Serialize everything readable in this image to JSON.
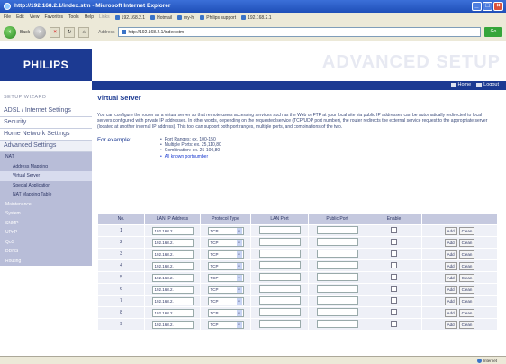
{
  "window": {
    "title": "http://192.168.2.1/index.stm - Microsoft Internet Explorer"
  },
  "menubar": {
    "items": [
      "File",
      "Edit",
      "View",
      "Favorites",
      "Tools",
      "Help"
    ],
    "links_label": "Links",
    "links": [
      "192.168.2.1",
      "Hotmail",
      "my-hi",
      "Philips support",
      "192.168.2.1"
    ]
  },
  "toolbar": {
    "back_label": "Back",
    "address_label": "Address",
    "address_value": "http://192.168.2.1/index.stm",
    "go_label": "Go"
  },
  "header": {
    "logo": "PHILIPS",
    "title": "ADVANCED SETUP",
    "home_label": "Home",
    "logout_label": "Logout"
  },
  "sidebar": {
    "wizard": "SETUP WIZARD",
    "items": [
      "ADSL / Internet Settings",
      "Security",
      "Home Network Settings",
      "Advanced Settings"
    ],
    "nat": "NAT",
    "nat_sub": [
      "Address Mapping",
      "Virtual Server",
      "Special Application",
      "NAT Mapping Table"
    ],
    "other": [
      "Maintenance",
      "System",
      "SNMP",
      "UPnP",
      "QoS",
      "DDNS",
      "Routing"
    ]
  },
  "main": {
    "title": "Virtual Server",
    "description": "You can configure the router as a virtual server so that remote users accessing services such as the Web or FTP at your local site via public IP addresses can be automatically redirected to local servers configured with private IP addresses. In other words, depending on the requested service (TCP/UDP port number), the router redirects the external service request to the appropriate server (located at another internal IP address). This tool can support both port ranges, multiple ports, and combinations of the two.",
    "for_example": "For example:",
    "examples": [
      "Port Ranges: ex. 100-150",
      "Multiple Ports: ex. 25,110,80",
      "Combination: ex. 25-100,80"
    ],
    "known_ports_link": "All known portnumber"
  },
  "table": {
    "headers": [
      "No.",
      "LAN IP Address",
      "Protocol Type",
      "LAN Port",
      "Public Port",
      "Enable",
      ""
    ],
    "ip_prefix": "192.168.2.",
    "protocol": "TCP",
    "add_label": "Add",
    "clean_label": "Clean",
    "rows": [
      "1",
      "2",
      "3",
      "4",
      "5",
      "6",
      "7",
      "8",
      "9"
    ]
  },
  "status": {
    "zone": "Internet"
  }
}
